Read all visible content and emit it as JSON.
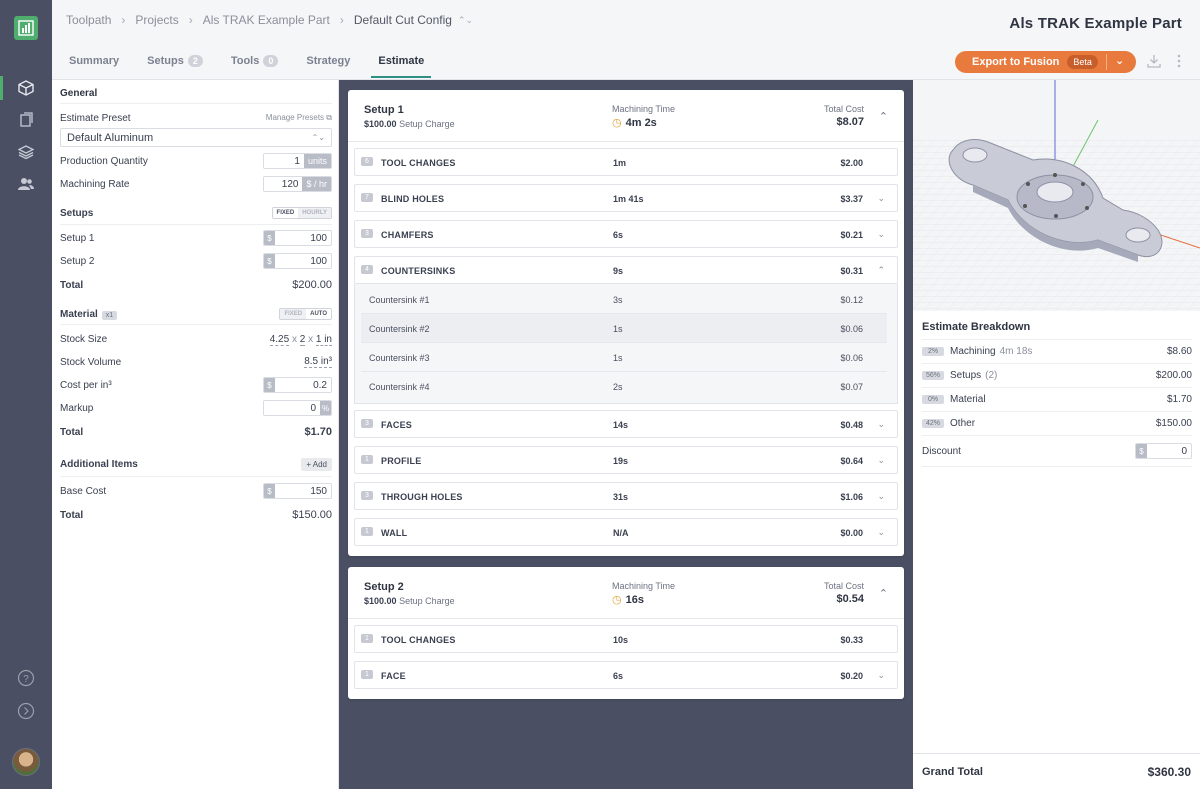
{
  "breadcrumbs": [
    "Toolpath",
    "Projects",
    "Als TRAK Example Part",
    "Default Cut Config"
  ],
  "part_title": "Als TRAK Example Part",
  "tabs": [
    {
      "label": "Summary",
      "count": ""
    },
    {
      "label": "Setups",
      "count": "2"
    },
    {
      "label": "Tools",
      "count": "0"
    },
    {
      "label": "Strategy",
      "count": ""
    },
    {
      "label": "Estimate",
      "count": ""
    }
  ],
  "export": {
    "label": "Export to Fusion",
    "badge": "Beta"
  },
  "left": {
    "general_title": "General",
    "estimate_preset_label": "Estimate Preset",
    "manage_presets": "Manage Presets",
    "preset_value": "Default Aluminum",
    "production_quantity_label": "Production Quantity",
    "production_quantity": "1",
    "production_quantity_unit": "units",
    "machining_rate_label": "Machining Rate",
    "machining_rate": "120",
    "machining_rate_unit": "$ / hr",
    "setups_title": "Setups",
    "toggle_fixed": "FIXED",
    "toggle_hourly": "HOURLY",
    "toggle_auto": "AUTO",
    "setup1_label": "Setup 1",
    "setup1_value": "100",
    "setup2_label": "Setup 2",
    "setup2_value": "100",
    "setups_total_label": "Total",
    "setups_total": "$200.00",
    "material_title": "Material",
    "material_badge": "x1",
    "stock_size_label": "Stock Size",
    "stock_size": [
      "4.25",
      "2",
      "1 in"
    ],
    "stock_volume_label": "Stock Volume",
    "stock_volume": "8.5 in³",
    "cost_per_label": "Cost per in³",
    "cost_per_value": "0.2",
    "markup_label": "Markup",
    "markup_value": "0",
    "markup_unit": "%",
    "material_total_label": "Total",
    "material_total": "$1.70",
    "additional_title": "Additional Items",
    "add_button": "+ Add",
    "base_cost_label": "Base Cost",
    "base_cost_value": "150",
    "additional_total_label": "Total",
    "additional_total": "$150.00",
    "dollar": "$",
    "times": "x"
  },
  "setup1": {
    "title": "Setup 1",
    "charge": "$100.00",
    "charge_label": "Setup Charge",
    "mt_label": "Machining Time",
    "mt_value": "4m 2s",
    "tc_label": "Total Cost",
    "tc_value": "$8.07",
    "ops": [
      {
        "n": "6",
        "name": "TOOL CHANGES",
        "time": "1m",
        "cost": "$2.00"
      },
      {
        "n": "7",
        "name": "BLIND HOLES",
        "time": "1m 41s",
        "cost": "$3.37"
      },
      {
        "n": "3",
        "name": "CHAMFERS",
        "time": "6s",
        "cost": "$0.21"
      },
      {
        "n": "4",
        "name": "COUNTERSINKS",
        "time": "9s",
        "cost": "$0.31"
      },
      {
        "n": "3",
        "name": "FACES",
        "time": "14s",
        "cost": "$0.48"
      },
      {
        "n": "1",
        "name": "PROFILE",
        "time": "19s",
        "cost": "$0.64"
      },
      {
        "n": "3",
        "name": "THROUGH HOLES",
        "time": "31s",
        "cost": "$1.06"
      },
      {
        "n": "1",
        "name": "WALL",
        "time": "N/A",
        "cost": "$0.00"
      }
    ],
    "countersinks": [
      {
        "name": "Countersink #1",
        "time": "3s",
        "cost": "$0.12"
      },
      {
        "name": "Countersink #2",
        "time": "1s",
        "cost": "$0.06"
      },
      {
        "name": "Countersink #3",
        "time": "1s",
        "cost": "$0.06"
      },
      {
        "name": "Countersink #4",
        "time": "2s",
        "cost": "$0.07"
      }
    ]
  },
  "setup2": {
    "title": "Setup 2",
    "charge": "$100.00",
    "charge_label": "Setup Charge",
    "mt_label": "Machining Time",
    "mt_value": "16s",
    "tc_label": "Total Cost",
    "tc_value": "$0.54",
    "ops": [
      {
        "n": "1",
        "name": "TOOL CHANGES",
        "time": "10s",
        "cost": "$0.33"
      },
      {
        "n": "1",
        "name": "FACE",
        "time": "6s",
        "cost": "$0.20"
      }
    ]
  },
  "breakdown": {
    "title": "Estimate Breakdown",
    "rows": [
      {
        "pct": "2%",
        "label": "Machining",
        "extra": "4m 18s",
        "value": "$8.60"
      },
      {
        "pct": "56%",
        "label": "Setups",
        "extra": "(2)",
        "value": "$200.00"
      },
      {
        "pct": "0%",
        "label": "Material",
        "extra": "",
        "value": "$1.70"
      },
      {
        "pct": "42%",
        "label": "Other",
        "extra": "",
        "value": "$150.00"
      }
    ],
    "discount_label": "Discount",
    "discount_value": "0",
    "grand_total_label": "Grand Total",
    "grand_total": "$360.30"
  }
}
